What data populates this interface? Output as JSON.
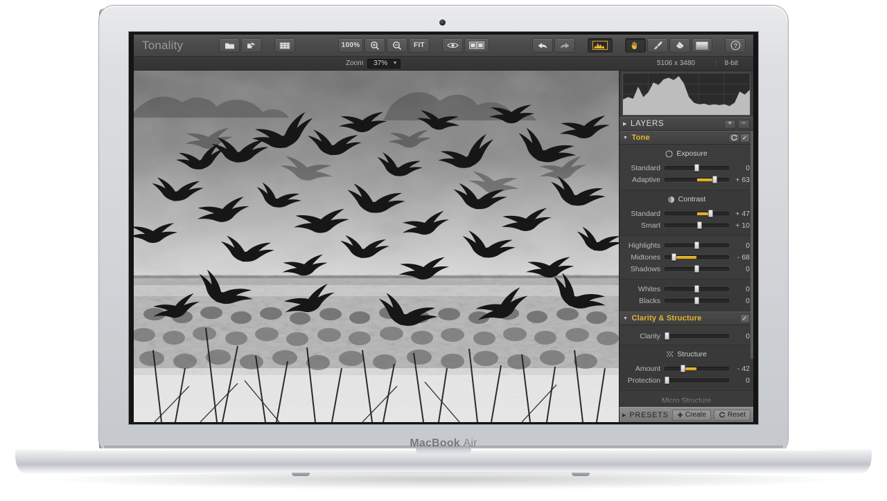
{
  "device": {
    "brand_bold": "MacBook",
    "brand_light": "Air"
  },
  "app": {
    "title": "Tonality",
    "toolbar": {
      "open_icon": "open-folder-icon",
      "export_icon": "share-export-icon",
      "crop_icon": "crop-grid-icon",
      "zoom_100_label": "100%",
      "zoom_in_icon": "zoom-in-icon",
      "zoom_out_icon": "zoom-out-icon",
      "fit_label": "FIT",
      "preview_icon": "eye-preview-icon",
      "compare_icon": "split-compare-icon",
      "undo_icon": "undo-arrow-icon",
      "redo_icon": "redo-arrow-icon",
      "histogram_icon": "histogram-icon",
      "hand_icon": "hand-tool-icon",
      "brush_icon": "brush-tool-icon",
      "eraser_icon": "eraser-tool-icon",
      "gradient_icon": "gradient-mask-icon",
      "help_label": "?"
    },
    "infobar": {
      "zoom_label": "Zoom",
      "zoom_value": "37%",
      "dimensions": "5106 x 3480",
      "bit_depth": "8-bit"
    },
    "panel": {
      "histogram_name": "histogram",
      "layers": {
        "label": "LAYERS",
        "add_label": "+",
        "remove_label": "−"
      },
      "sections": [
        {
          "name": "tone",
          "label": "Tone",
          "expanded": true,
          "reset_icon": "reset-circular-arrows-icon",
          "checked": "✓",
          "groups": [
            {
              "title": "Exposure",
              "icon": "aperture-icon",
              "sliders": [
                {
                  "label": "Standard",
                  "value": "0",
                  "pos": 50,
                  "fill_from": 50
                },
                {
                  "label": "Adaptive",
                  "value": "+ 63",
                  "pos": 78,
                  "fill_from": 50
                }
              ]
            },
            {
              "title": "Contrast",
              "icon": "contrast-half-circle-icon",
              "sliders": [
                {
                  "label": "Standard",
                  "value": "+ 47",
                  "pos": 72,
                  "fill_from": 50
                },
                {
                  "label": "Smart",
                  "value": "+ 10",
                  "pos": 54,
                  "fill_from": 50
                }
              ]
            },
            {
              "title": "",
              "icon": "",
              "sliders": [
                {
                  "label": "Highlights",
                  "value": "0",
                  "pos": 50,
                  "fill_from": 50
                },
                {
                  "label": "Midtones",
                  "value": "- 68",
                  "pos": 14,
                  "fill_from": 50
                },
                {
                  "label": "Shadows",
                  "value": "0",
                  "pos": 50,
                  "fill_from": 50
                }
              ]
            },
            {
              "title": "",
              "icon": "",
              "sliders": [
                {
                  "label": "Whites",
                  "value": "0",
                  "pos": 50,
                  "fill_from": 50
                },
                {
                  "label": "Blacks",
                  "value": "0",
                  "pos": 50,
                  "fill_from": 50
                }
              ]
            }
          ]
        },
        {
          "name": "clarity-structure",
          "label": "Clarity & Structure",
          "expanded": true,
          "checked": "✓",
          "groups": [
            {
              "title": "",
              "icon": "",
              "sliders": [
                {
                  "label": "Clarity",
                  "value": "0",
                  "pos": 2,
                  "fill_from": 2
                }
              ]
            },
            {
              "title": "Structure",
              "icon": "structure-dots-icon",
              "sliders": [
                {
                  "label": "Amount",
                  "value": "- 42",
                  "pos": 28,
                  "fill_from": 50
                },
                {
                  "label": "Protection",
                  "value": "0",
                  "pos": 2,
                  "fill_from": 2
                }
              ]
            }
          ]
        }
      ],
      "cut_off_label": "Micro Structure",
      "presets": {
        "label": "PRESETS",
        "create_label": "Create",
        "create_icon": "plus-icon",
        "reset_label": "Reset",
        "reset_icon": "reset-circular-arrows-icon"
      }
    },
    "canvas": {
      "image_description": "Black and white photograph of a large flock of birds taking flight over a misty marsh"
    }
  },
  "colors": {
    "accent": "#e8b530",
    "slider_fill": "#f0c13b",
    "panel_bg": "#3a3a3a",
    "toolbar_bg": "#4a4a4a"
  },
  "chart_data": {
    "type": "area",
    "title": "Luminance histogram",
    "x": [
      0,
      4,
      8,
      12,
      16,
      20,
      24,
      28,
      32,
      36,
      40,
      44,
      48,
      52,
      56,
      60,
      64,
      68,
      72,
      76,
      80,
      84,
      88,
      92,
      96,
      100
    ],
    "values": [
      38,
      44,
      40,
      70,
      44,
      56,
      80,
      74,
      88,
      92,
      86,
      96,
      78,
      44,
      30,
      26,
      28,
      24,
      26,
      24,
      26,
      22,
      30,
      58,
      50,
      62
    ],
    "xlabel": "",
    "ylabel": "",
    "ylim": [
      0,
      100
    ],
    "grid": true
  }
}
